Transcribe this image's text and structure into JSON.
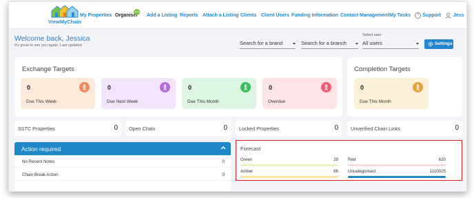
{
  "brand": {
    "logo_text": "ViewMyChain",
    "colors": {
      "primary": "#1e88c9",
      "forecast_border": "#e01b1b"
    }
  },
  "nav": {
    "items": [
      {
        "label": "My Properties"
      },
      {
        "label": "Organiser"
      },
      {
        "label": "Add a Listing"
      },
      {
        "label": "Reports"
      },
      {
        "label": "Attach a Listing"
      },
      {
        "label": "Clients"
      },
      {
        "label": "Client Users"
      },
      {
        "label": "Funding Information"
      },
      {
        "label": "Contact Management"
      },
      {
        "label": "My Tasks"
      },
      {
        "label": "Support"
      },
      {
        "label": "Jess"
      }
    ],
    "badge": "new"
  },
  "welcome": {
    "title": "Welcome back, Jessica",
    "subtitle": "It's great to see you again. Last updated"
  },
  "filters": {
    "brand_placeholder": "Search for a brand",
    "branch_placeholder": "Search for a branch",
    "user_label": "Select user",
    "user_value": "All users",
    "settings_label": "Settings"
  },
  "exchange": {
    "title": "Exchange Targets",
    "tiles": [
      {
        "value": "0",
        "label": "Due This Week",
        "bg": "#fde9d9",
        "icon_color": "#f08a5d"
      },
      {
        "value": "0",
        "label": "Due Next Week",
        "bg": "#f1e4fb",
        "icon_color": "#b36ae0"
      },
      {
        "value": "0",
        "label": "Due This Month",
        "bg": "#dcf5e2",
        "icon_color": "#39bf5c"
      },
      {
        "value": "0",
        "label": "Overdue",
        "bg": "#fde3e5",
        "icon_color": "#ef5b71"
      }
    ]
  },
  "completion": {
    "title": "Completion Targets",
    "tiles": [
      {
        "value": "0",
        "label": "Due This Month",
        "bg": "#fdf0d9",
        "icon_color": "#e6a23c"
      }
    ]
  },
  "stats": [
    {
      "label": "SSTC Properties",
      "value": "0"
    },
    {
      "label": "Open Chain",
      "value": "0"
    },
    {
      "label": "Locked Properties",
      "value": "0"
    },
    {
      "label": "Unverified Chain Links",
      "value": "0"
    }
  ],
  "action_required": {
    "title": "Action required",
    "rows": [
      {
        "label": "No Recent Notes",
        "value": "0"
      },
      {
        "label": "Chain Break Action",
        "value": "0"
      }
    ]
  },
  "forecast": {
    "title": "Forecast",
    "items": [
      {
        "label": "Green",
        "value": "29",
        "bar_color": "#e8f6c2"
      },
      {
        "label": "Red",
        "value": "620",
        "bar_color": "#f5dddd"
      },
      {
        "label": "Amber",
        "value": "66",
        "bar_color": "#f9e7a3"
      },
      {
        "label": "Uncategorised",
        "value": "1110025",
        "bar_color": "#1e88c9"
      }
    ]
  }
}
